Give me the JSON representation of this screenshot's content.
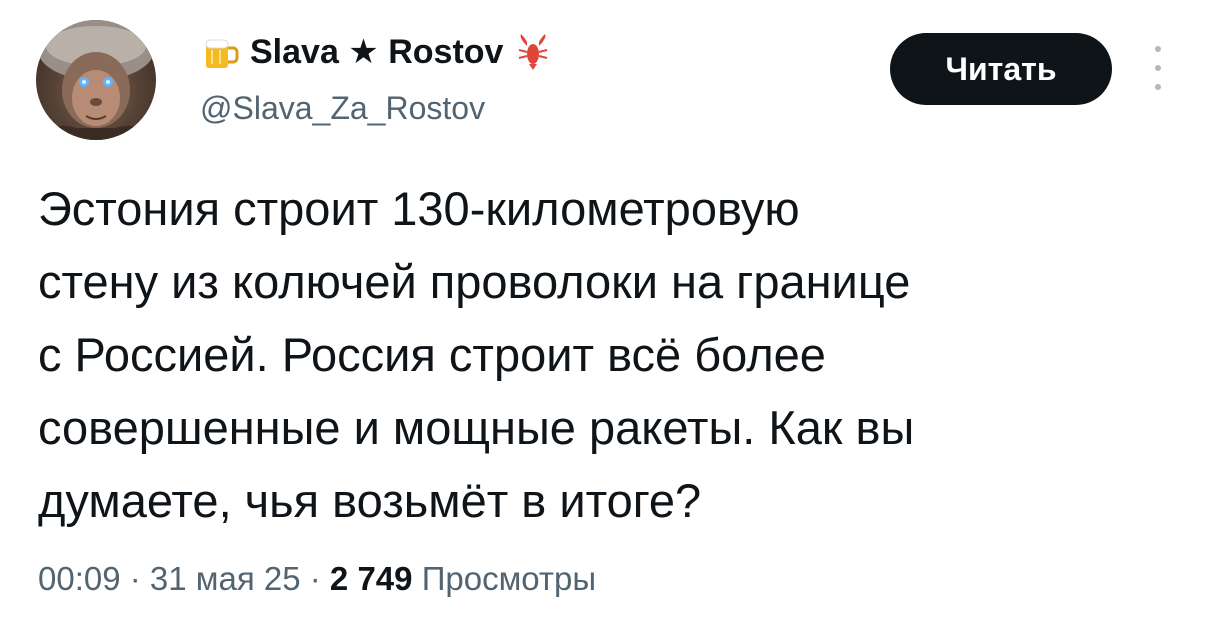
{
  "author": {
    "display_name": "Slava ★ Rostov",
    "handle": "@Slava_Za_Rostov",
    "name_prefix_icon": "beer-mug-icon",
    "name_suffix_icon": "lobster-icon",
    "avatar_icon": "monkey-avatar"
  },
  "follow_button": {
    "label": "Читать"
  },
  "more_menu_icon": "vertical-ellipsis-icon",
  "tweet": {
    "text": "Эстония строит 130-километровую\nстену из колючей проволоки на границе\nс Россией. Россия строит всё более\nсовершенные и мощные ракеты. Как вы\nдумаете, чья возьмёт в итоге?"
  },
  "meta": {
    "time": "00:09",
    "separator": " · ",
    "date": "31 мая 25",
    "views_count": "2 749",
    "views_label": "Просмотры"
  },
  "colors": {
    "text_primary": "#0f1419",
    "text_secondary": "#536471",
    "button_bg": "#0f1419",
    "button_text": "#ffffff"
  }
}
